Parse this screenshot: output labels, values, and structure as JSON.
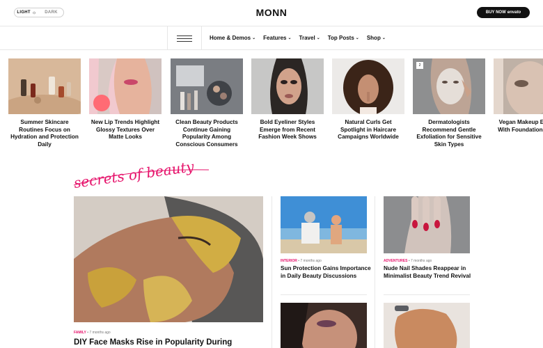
{
  "header": {
    "mode_light": "LIGHT",
    "mode_dark": "DARK",
    "logo": "MONN",
    "buy_label": "BUY NOW",
    "buy_brand": "envato"
  },
  "nav": {
    "items": [
      "Home & Demos",
      "Features",
      "Travel",
      "Top Posts",
      "Shop"
    ]
  },
  "stories": [
    {
      "title": "Summer Skincare Routines Focus on Hydration and Protection Daily"
    },
    {
      "title": "New Lip Trends Highlight Glossy Textures Over Matte Looks"
    },
    {
      "title": "Clean Beauty Products Continue Gaining Popularity Among Conscious Consumers"
    },
    {
      "title": "Bold Eyeliner Styles Emerge from Recent Fashion Week Shows"
    },
    {
      "title": "Natural Curls Get Spotlight in Haircare Campaigns Worldwide"
    },
    {
      "title": "Dermatologists Recommend Gentle Exfoliation for Sensitive Skin Types",
      "badge": "2"
    },
    {
      "title": "Vegan Makeup Expand With Foundation Range"
    }
  ],
  "section": {
    "script_title": "secrets of beauty"
  },
  "feature": {
    "category": "FAMILY",
    "time": "7 months ago",
    "title": "DIY Face Masks Rise in Popularity During"
  },
  "cards": [
    {
      "category": "INTERIOR",
      "time": "7 months ago",
      "title": "Sun Protection Gains Importance in Daily Beauty Discussions"
    },
    {
      "category": "ADVENTURES",
      "time": "7 months ago",
      "title": "Nude Nail Shades Reappear in Minimalist Beauty Trend Revival"
    }
  ],
  "colors": {
    "accent": "#e6136b",
    "text": "#111111",
    "line": "#e6e6e6"
  }
}
